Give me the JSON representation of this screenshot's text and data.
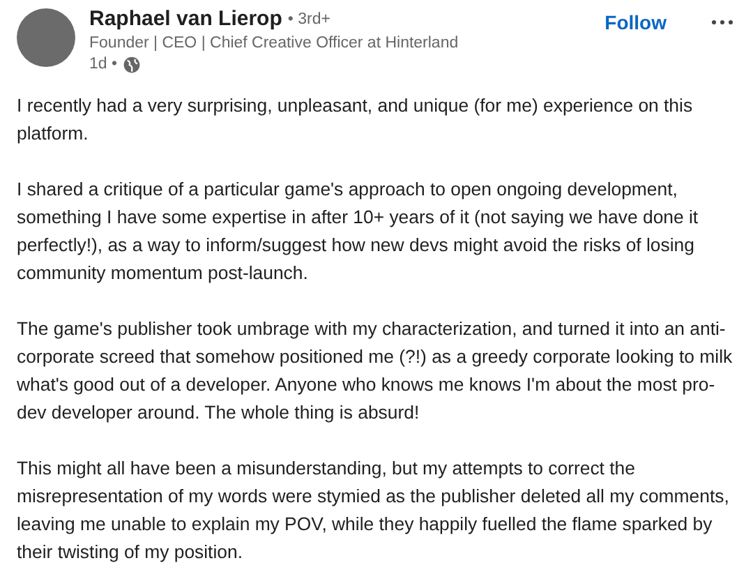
{
  "author": {
    "name": "Raphael van Lierop",
    "degree": "• 3rd+",
    "headline": "Founder | CEO | Chief Creative Officer at Hinterland",
    "time": "1d •"
  },
  "follow_button": "Follow",
  "paragraphs": [
    "I recently had a very surprising, unpleasant, and unique (for me) experience on this platform.",
    "I shared a critique of a particular game's approach to open ongoing development, something I have some expertise in after 10+ years of it (not saying we have done it perfectly!), as a way to inform/suggest how new devs might avoid the risks of losing community momentum post-launch.",
    "The game's publisher took umbrage with my characterization, and turned it into an anti-corporate screed that somehow positioned me (?!) as a greedy corporate looking to milk what's good out of a developer. Anyone who knows me knows I'm about the most pro-dev developer around. The whole thing is absurd!",
    "This might all have been a misunderstanding, but my attempts to correct the misrepresentation of my words were stymied as the publisher deleted all my comments, leaving me unable to explain my POV, while they happily fuelled the flame sparked by their twisting of my position."
  ]
}
